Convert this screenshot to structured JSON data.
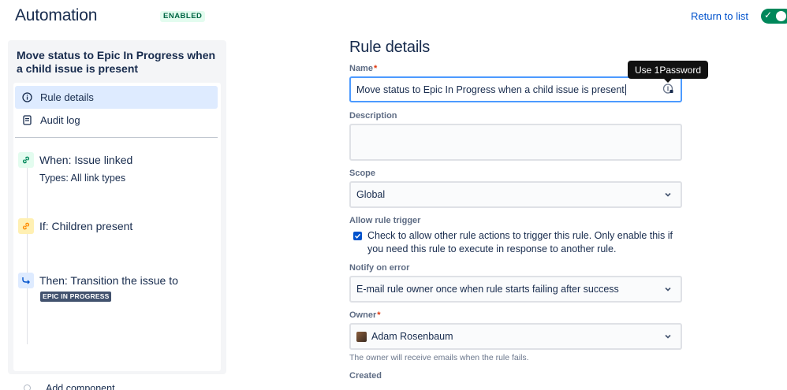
{
  "header": {
    "title": "Automation",
    "status": "ENABLED",
    "return_link": "Return to list"
  },
  "sidebar": {
    "rule_name": "Move status to Epic In Progress when a child issue is present",
    "nav": [
      {
        "label": "Rule details",
        "icon": "info-icon",
        "active": true
      },
      {
        "label": "Audit log",
        "icon": "document-icon",
        "active": false
      }
    ],
    "components": {
      "trigger": {
        "title": "When: Issue linked",
        "subtitle": "Types: All link types",
        "icon": "link-icon"
      },
      "condition": {
        "title": "If: Children present",
        "icon": "link-icon"
      },
      "action": {
        "title": "Then: Transition the issue to",
        "lozenge": "EPIC IN PROGRESS",
        "icon": "transition-icon"
      }
    },
    "add_component": "Add component"
  },
  "form": {
    "title": "Rule details",
    "name": {
      "label": "Name",
      "value": "Move status to Epic In Progress when a child issue is present"
    },
    "tooltip": "Use 1Password",
    "description": {
      "label": "Description",
      "value": ""
    },
    "scope": {
      "label": "Scope",
      "value": "Global"
    },
    "allow_trigger": {
      "label": "Allow rule trigger",
      "checked": true,
      "text": "Check to allow other rule actions to trigger this rule. Only enable this if you need this rule to execute in response to another rule."
    },
    "notify": {
      "label": "Notify on error",
      "value": "E-mail rule owner once when rule starts failing after success"
    },
    "owner": {
      "label": "Owner",
      "value": "Adam Rosenbaum",
      "help": "The owner will receive emails when the rule fails."
    },
    "created": {
      "label": "Created"
    }
  },
  "colors": {
    "accent": "#0052cc",
    "enabled_green": "#00875a",
    "focus_border": "#4c9aff",
    "trigger_icon_bg": "#e3fcef",
    "condition_icon_bg": "#fff0b3",
    "action_icon_bg": "#deebff",
    "lozenge_bg": "#42526e"
  }
}
